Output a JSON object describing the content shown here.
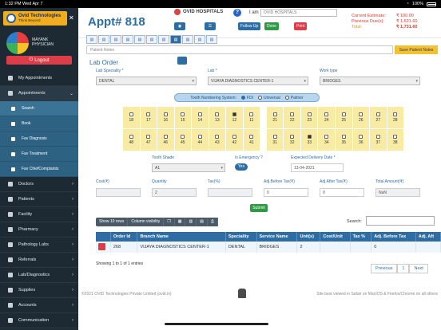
{
  "status_bar": {
    "time": "1:32 PM  Wed Apr 7",
    "battery": "100%"
  },
  "sidebar": {
    "logo_title": "Ovid Technologies",
    "logo_sub": "Think Beyond",
    "user_name": "MAYANK",
    "user_role": "PHYSICIAN",
    "logout_label": "Logout",
    "items": [
      {
        "label": "My Appointments"
      },
      {
        "label": "Appointments"
      },
      {
        "label": "Search"
      },
      {
        "label": "Book"
      },
      {
        "label": "Fav Diagnosis"
      },
      {
        "label": "Fav Treatment"
      },
      {
        "label": "Fav ChiefComplaints"
      },
      {
        "label": "Doctors"
      },
      {
        "label": "Patients"
      },
      {
        "label": "Facility"
      },
      {
        "label": "Pharmacy"
      },
      {
        "label": "Pathology Labs"
      },
      {
        "label": "Referrals"
      },
      {
        "label": "Lab/Diagnostics"
      },
      {
        "label": "Supplies"
      },
      {
        "label": "Accounts"
      },
      {
        "label": "Communication"
      }
    ]
  },
  "header": {
    "appt_title": "Appt# 818",
    "hospital": "OVID HOSPITALS",
    "follow_up_label": "Follow Up",
    "done_label": "Done",
    "print_label": "Print",
    "iam_label": "I am",
    "hospital_select": "OVID HOSPITALS",
    "current_estimate_label": "Current Estimate:",
    "current_estimate_value": "₹ 100.00",
    "previous_dues_label": "Previous Due(s):",
    "previous_dues_value": "₹ 1,631.60",
    "total_label": "Total:",
    "total_value": "₹ 1,731.60"
  },
  "notes": {
    "placeholder": "Patient Notes",
    "save_label": "Save Patient Notes"
  },
  "lab_order": {
    "title": "Lab Order",
    "lab_speciality_label": "Lab Speciality *",
    "lab_speciality_value": "DENTAL",
    "lab_label": "Lab *",
    "lab_value": "VIJAYA DIAGNOSTICS CENTER-1",
    "work_type_label": "Work type",
    "work_type_value": "BRIDGES",
    "tooth_system_label": "Tooth Numbering System:",
    "tooth_system_options": [
      "FDI",
      "Universal",
      "Palmer"
    ],
    "upper_teeth": [
      "18",
      "17",
      "16",
      "15",
      "14",
      "13",
      "12",
      "11",
      "21",
      "22",
      "23",
      "24",
      "25",
      "26",
      "27",
      "28"
    ],
    "lower_teeth": [
      "48",
      "47",
      "46",
      "45",
      "44",
      "43",
      "42",
      "41",
      "31",
      "32",
      "33",
      "34",
      "35",
      "36",
      "37",
      "38"
    ],
    "tooth_shade_label": "Tooth Shade",
    "tooth_shade_value": "A1",
    "emergency_label": "Is Emergency ?",
    "emergency_value": "Yes",
    "delivery_label": "Expected Delivery Date *",
    "delivery_value": "13-04-2021",
    "cost_label": "Cost(₹)",
    "quantity_label": "Quantity",
    "quantity_value": "2",
    "tax_label": "Tax(%)",
    "adj_before_label": "Adj.Before Tax(₹)",
    "adj_before_value": "0",
    "adj_after_label": "Adj.After Tax(₹)",
    "adj_after_value": "0",
    "total_amount_label": "Total Amount(₹)",
    "total_amount_value": "NaN",
    "submit_label": "Submit"
  },
  "table": {
    "show_rows_label": "Show 10 rows",
    "column_visibility_label": "Column visibility",
    "search_label": "Search:",
    "columns": [
      "",
      "Order Id",
      "Branch Name",
      "Speciality",
      "Service Name",
      "Unit(s)",
      "Cost/Unit",
      "Tax %",
      "Adj. Before Tax",
      "Adj. Aft"
    ],
    "rows": [
      [
        "",
        "268",
        "VIJAYA DIAGNOSTICS CENTER-1",
        "DENTAL",
        "BRIDGES",
        "2",
        "",
        "",
        "0",
        ""
      ]
    ],
    "showing": "Showing 1 to 1 of 1 entries",
    "pager": [
      "Previous",
      "1",
      "Next"
    ]
  },
  "footer": {
    "copyright": "©2021 OVID Technologies Private Limited (ovid.in)",
    "best_viewed": "Site best viewed in Safari on MacIOS & Firefox/Chrome on all others"
  }
}
